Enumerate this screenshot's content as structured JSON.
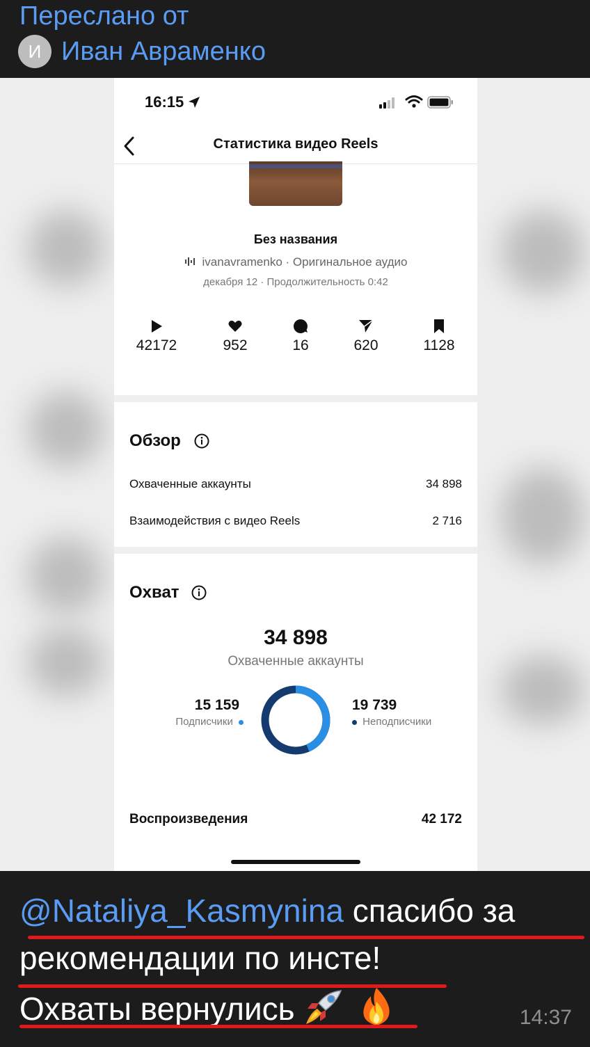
{
  "forward": {
    "label": "Переслано от",
    "avatar_letter": "И",
    "author": "Иван Авраменко"
  },
  "phone": {
    "status_time": "16:15",
    "title": "Статистика видео Reels",
    "reel": {
      "title": "Без названия",
      "meta": "ivanavramenko · Оригинальное аудио",
      "date": "декабря 12 · Продолжительность 0:42"
    },
    "metrics": [
      {
        "icon": "play-icon",
        "value": "42172"
      },
      {
        "icon": "heart-icon",
        "value": "952"
      },
      {
        "icon": "comment-icon",
        "value": "16"
      },
      {
        "icon": "share-icon",
        "value": "620"
      },
      {
        "icon": "bookmark-icon",
        "value": "1128"
      }
    ],
    "overview": {
      "title": "Обзор",
      "rows": [
        {
          "label": "Охваченные аккаунты",
          "value": "34 898"
        },
        {
          "label": "Взаимодействия с видео Reels",
          "value": "2 716"
        }
      ]
    },
    "reach": {
      "title": "Охват",
      "total": "34 898",
      "total_label": "Охваченные аккаунты",
      "followers": {
        "value": "15 159",
        "label": "Подписчики",
        "color": "#2a8ee4"
      },
      "non_followers": {
        "value": "19 739",
        "label": "Неподписчики",
        "color": "#143a6e"
      }
    },
    "plays": {
      "label": "Воспроизведения",
      "value": "42 172"
    }
  },
  "caption": {
    "mention": "@Nataliya_Kasmynina",
    "line1_rest": " спасибо за",
    "line2": "рекомендации по инсте!",
    "line3": "Охваты вернулись",
    "time": "14:37",
    "underline_color": "#e01a1a"
  }
}
